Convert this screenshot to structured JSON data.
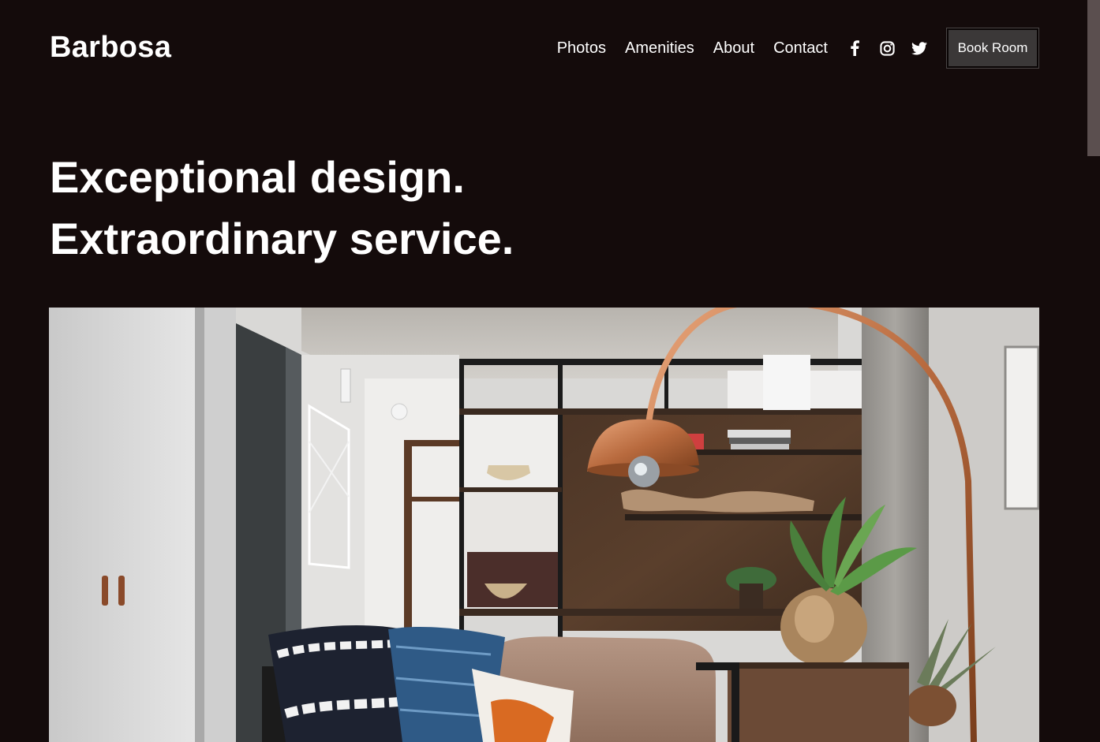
{
  "header": {
    "brand": "Barbosa",
    "nav": [
      {
        "label": "Photos"
      },
      {
        "label": "Amenities"
      },
      {
        "label": "About"
      },
      {
        "label": "Contact"
      }
    ],
    "social": [
      {
        "icon": "facebook-icon"
      },
      {
        "icon": "instagram-icon"
      },
      {
        "icon": "twitter-icon"
      }
    ],
    "cta_label": "Book Room"
  },
  "hero": {
    "line1": "Exceptional design.",
    "line2": "Extraordinary service."
  },
  "colors": {
    "background": "#140b0b",
    "button": "#3b3838",
    "text": "#ffffff"
  }
}
